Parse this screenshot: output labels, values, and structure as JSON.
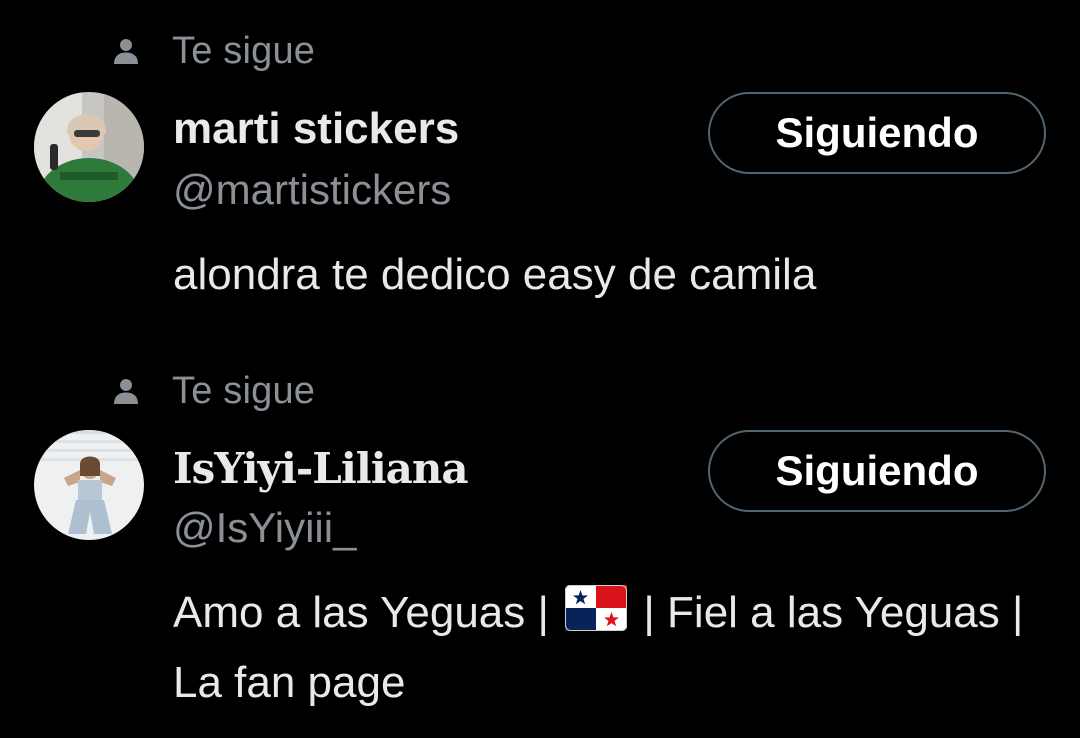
{
  "users": [
    {
      "follows_you_label": "Te sigue",
      "display_name": "marti stickers",
      "handle": "@martistickers",
      "follow_button_label": "Siguiendo",
      "bio": "alondra te dedico easy de camila"
    },
    {
      "follows_you_label": "Te sigue",
      "display_name": "IsYiyi-Liliana",
      "handle": "@IsYiyiii_",
      "follow_button_label": "Siguiendo",
      "bio_part1": "Amo a las Yeguas |",
      "bio_emoji": "panama-flag-emoji",
      "bio_part2": "| Fiel a las Yeguas | La fan page"
    }
  ],
  "colors": {
    "background": "#000000",
    "primary_text": "#e7e9ea",
    "secondary_text": "#8b9096",
    "button_border": "#536471"
  }
}
